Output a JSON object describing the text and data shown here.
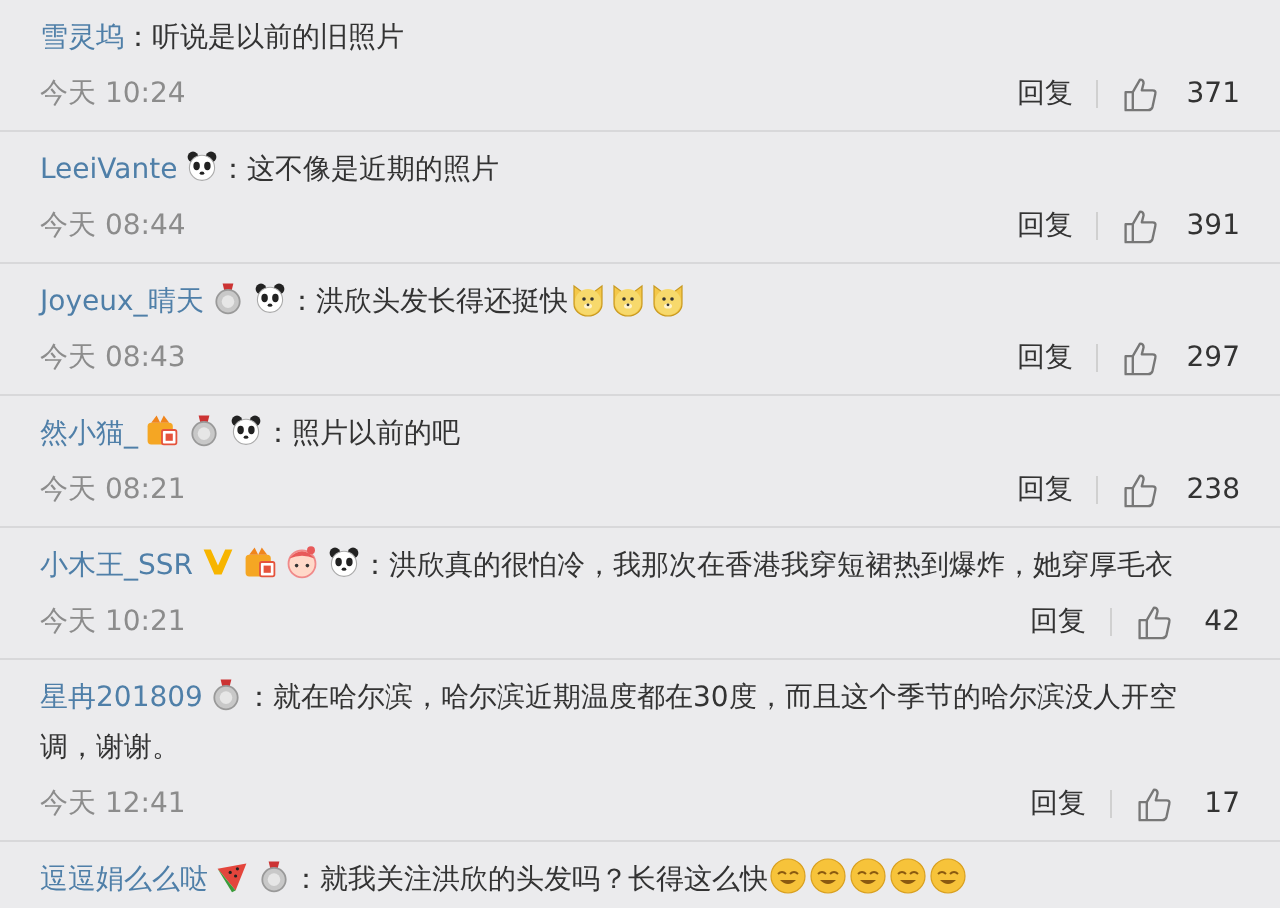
{
  "comments": [
    {
      "user": "雪灵坞",
      "text": "：听说是以前的旧照片",
      "time": "今天 10:24",
      "reply": "回复",
      "likes": "371"
    },
    {
      "user": "LeeiVante",
      "badges": [
        {
          "kind": "panda"
        }
      ],
      "text": "：这不像是近期的照片",
      "time": "今天 08:44",
      "reply": "回复",
      "likes": "391"
    },
    {
      "user": "Joyeux_晴天",
      "badges": [
        {
          "kind": "medal"
        },
        {
          "kind": "panda"
        }
      ],
      "text": "：洪欣头发长得还挺快",
      "emojis": [
        {
          "kind": "doge"
        },
        {
          "kind": "doge"
        },
        {
          "kind": "doge"
        }
      ],
      "time": "今天 08:43",
      "reply": "回复",
      "likes": "297"
    },
    {
      "user": "然小猫_",
      "badges": [
        {
          "kind": "vip"
        },
        {
          "kind": "medal"
        },
        {
          "kind": "panda"
        }
      ],
      "text": "：照片以前的吧",
      "time": "今天 08:21",
      "reply": "回复",
      "likes": "238"
    },
    {
      "user": "小木王_SSR",
      "badges": [
        {
          "kind": "v"
        },
        {
          "kind": "vip"
        },
        {
          "kind": "girl"
        },
        {
          "kind": "panda"
        }
      ],
      "text": "：洪欣真的很怕冷，我那次在香港我穿短裙热到爆炸，她穿厚毛衣",
      "time": "今天 10:21",
      "reply": "回复",
      "likes": "42"
    },
    {
      "user": "星冉201809",
      "badges": [
        {
          "kind": "medal"
        }
      ],
      "text": "：就在哈尔滨，哈尔滨近期温度都在30度，而且这个季节的哈尔滨没人开空",
      "text_continued": "调，谢谢。",
      "time": "今天 12:41",
      "reply": "回复",
      "likes": "17"
    },
    {
      "user": "逗逗娟么么哒",
      "badges": [
        {
          "kind": "watermelon"
        },
        {
          "kind": "medal"
        }
      ],
      "text": "：就我关注洪欣的头发吗？长得这么快",
      "emojis": [
        {
          "kind": "smile"
        },
        {
          "kind": "smile"
        },
        {
          "kind": "smile"
        },
        {
          "kind": "smile"
        },
        {
          "kind": "smile"
        }
      ]
    }
  ]
}
